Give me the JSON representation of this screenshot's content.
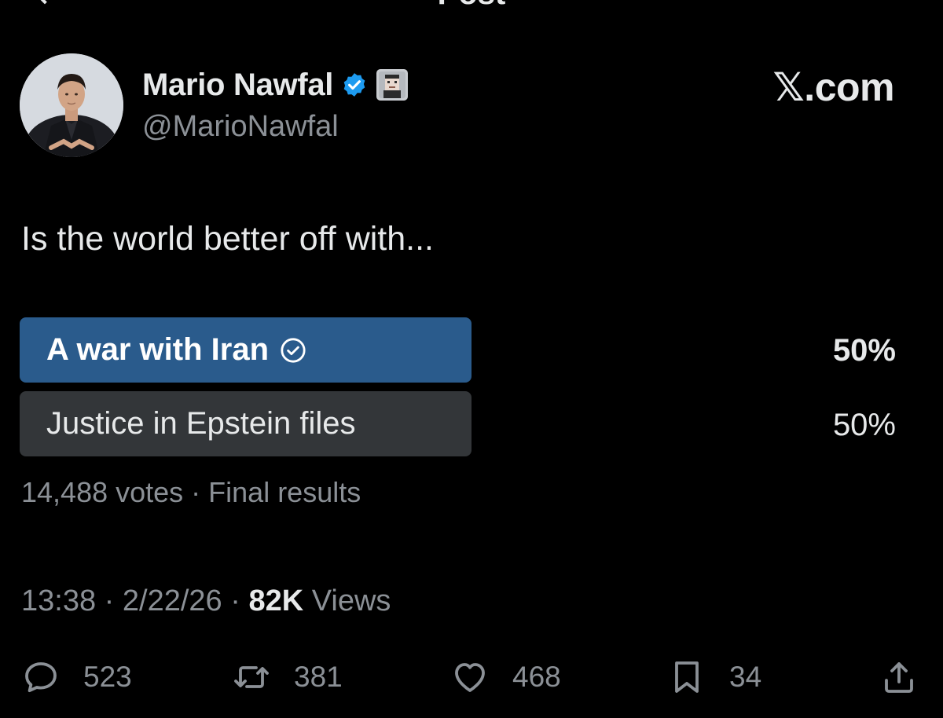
{
  "header": {
    "title": "Post"
  },
  "author": {
    "display_name": "Mario Nawfal",
    "handle": "@MarioNawfal",
    "verified": true
  },
  "brand": {
    "label": "𝕏.com"
  },
  "post": {
    "text": "Is the world better off with..."
  },
  "poll": {
    "options": [
      {
        "label": "A war with Iran",
        "percent": "50%",
        "selected": true
      },
      {
        "label": "Justice in Epstein files",
        "percent": "50%",
        "selected": false
      }
    ],
    "votes": "14,488 votes",
    "separator": " · ",
    "status": "Final results"
  },
  "meta": {
    "time": "13:38",
    "date": "2/22/26",
    "separator": " · ",
    "views_count": "82K",
    "views_label": "Views"
  },
  "actions": {
    "replies": "523",
    "reposts": "381",
    "likes": "468",
    "bookmarks": "34"
  },
  "colors": {
    "background": "#000000",
    "text_primary": "#e7e9ea",
    "text_secondary": "#8b9096",
    "poll_selected": "#2a5b8c",
    "poll_unselected": "#333639",
    "verified_badge": "#1d9bf0"
  },
  "icons": {
    "verified": "verified-badge-icon",
    "affiliate": "affiliate-badge-icon",
    "reply": "reply-icon",
    "repost": "repost-icon",
    "like": "heart-icon",
    "bookmark": "bookmark-icon",
    "share": "share-icon",
    "poll_check": "check-circle-icon"
  }
}
